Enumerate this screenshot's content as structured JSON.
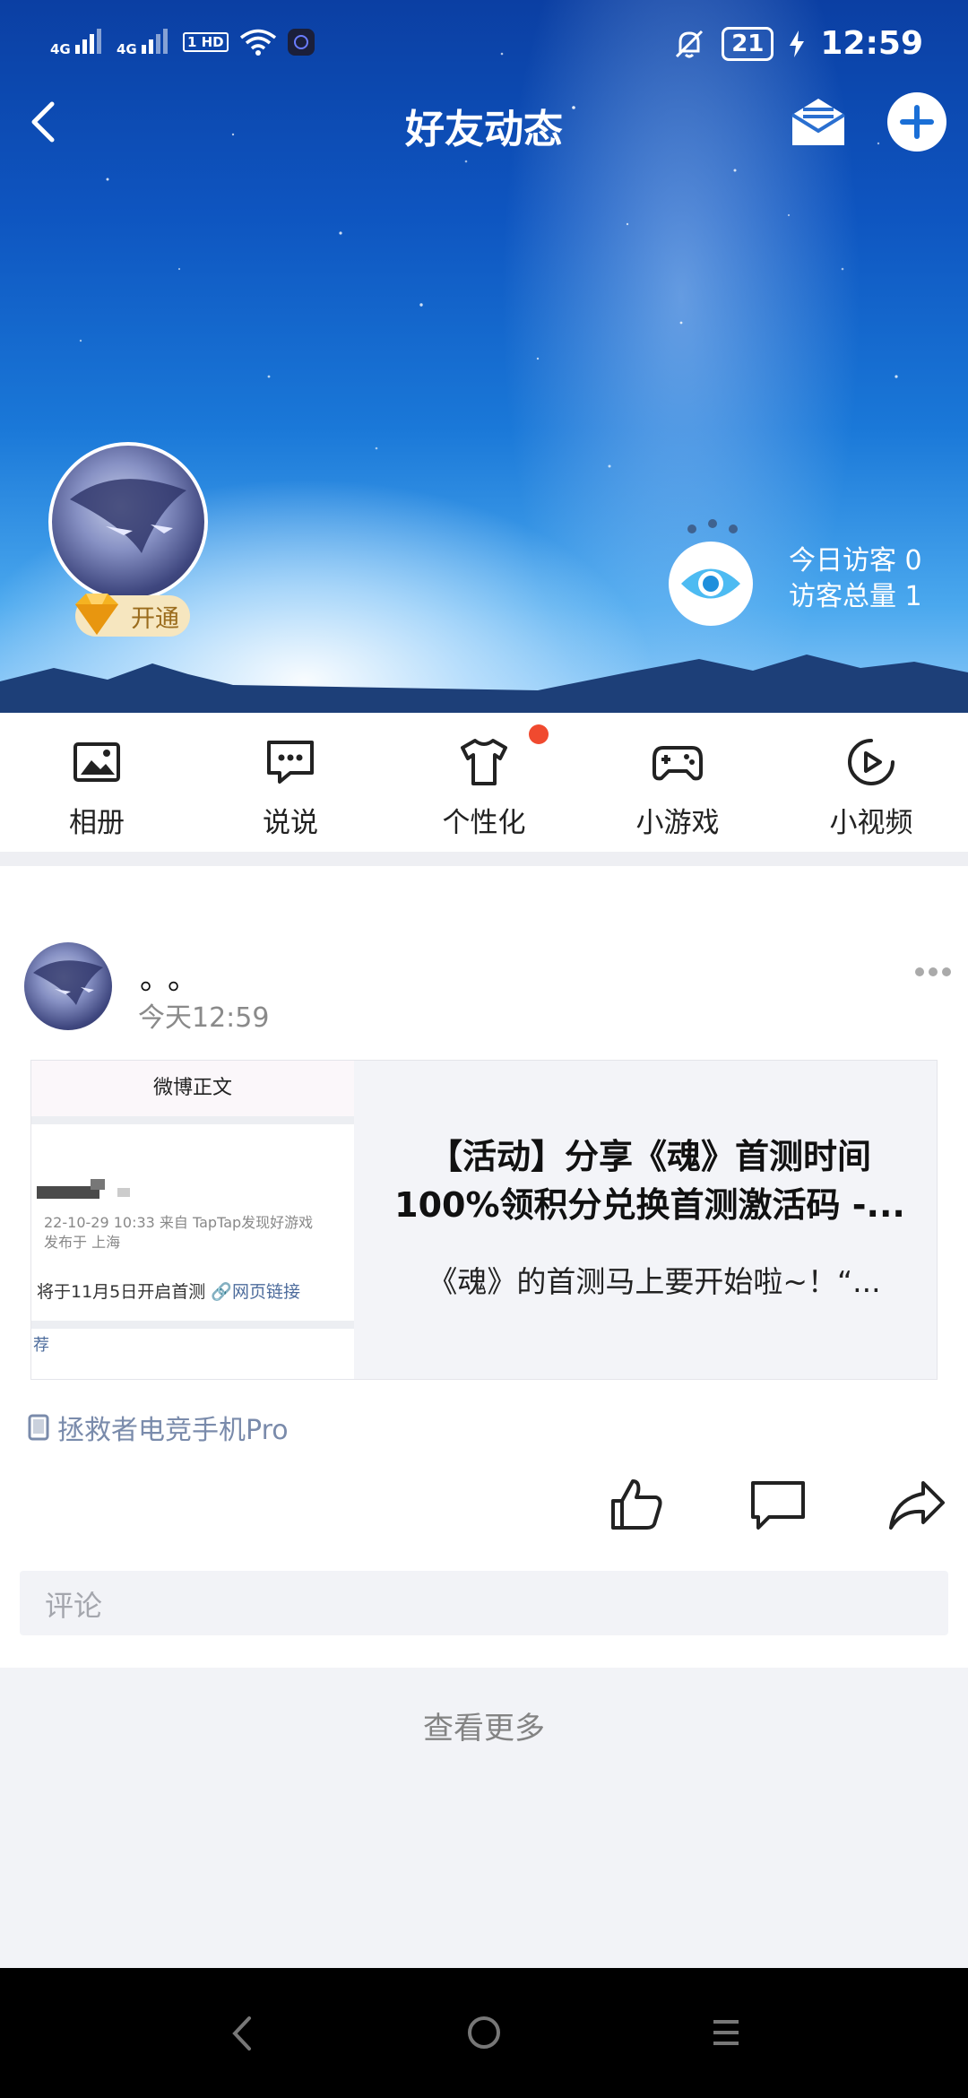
{
  "status_bar": {
    "signal_left": [
      "4G",
      "4G",
      "1 HD"
    ],
    "battery": "21",
    "time": "12:59"
  },
  "header": {
    "title": "好友动态",
    "icons": [
      "back-icon",
      "mail-icon",
      "plus-icon"
    ]
  },
  "profile": {
    "vip_label": "开通",
    "visitors_today": "今日访客 0",
    "visitors_total": "访客总量 1"
  },
  "features": [
    {
      "label": "相册",
      "icon": "photo-album-icon"
    },
    {
      "label": "说说",
      "icon": "chat-bubble-icon"
    },
    {
      "label": "个性化",
      "icon": "tshirt-icon"
    },
    {
      "label": "小游戏",
      "icon": "gamepad-icon"
    },
    {
      "label": "小视频",
      "icon": "play-circle-icon"
    }
  ],
  "post": {
    "name": "。。",
    "time": "今天12:59",
    "card": {
      "thumb_title": "微博正文",
      "thumb_meta_1": "22-10-29 10:33  来自 TapTap发现好游戏",
      "thumb_meta_2": "发布于 上海",
      "thumb_line": "将于11月5日开启首测",
      "thumb_link": "网页链接",
      "thumb_rec": "荐",
      "title": "【活动】分享《魂》首测时间100%领积分兑换首测激活码 -...",
      "desc": "《魂》的首测马上要开始啦~！“..."
    },
    "device": "拯救者电竞手机Pro",
    "comment_placeholder": "评论"
  },
  "see_more": "查看更多",
  "colors": {
    "accent_link": "#7a8bab",
    "red_dot": "#f04a2f"
  }
}
